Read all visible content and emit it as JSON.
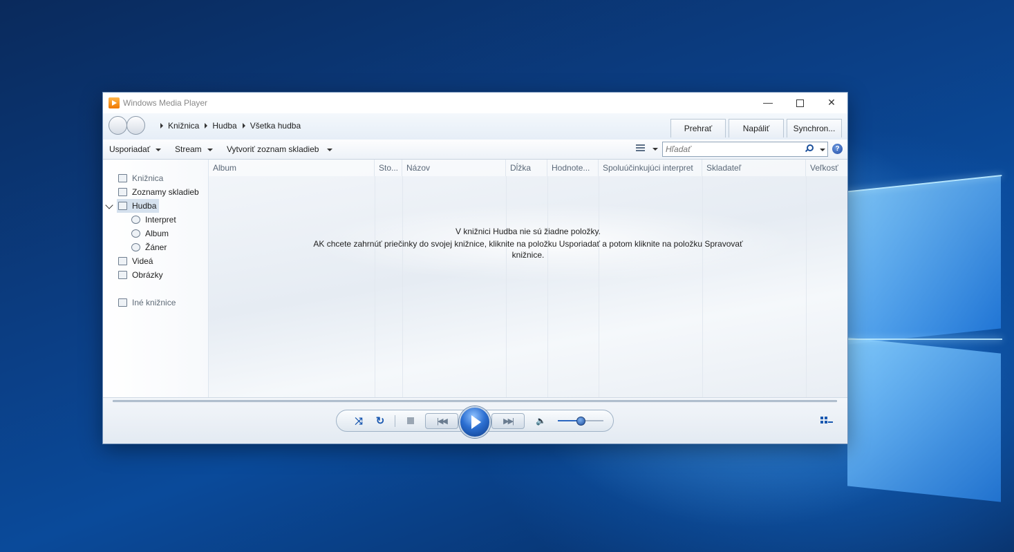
{
  "window": {
    "title": "Windows Media Player",
    "controls": {
      "minimize": "—",
      "close": "✕"
    }
  },
  "breadcrumb": [
    "Knižnica",
    "Hudba",
    "Všetka hudba"
  ],
  "tabs": {
    "play": "Prehrať",
    "burn": "Napáliť",
    "sync": "Synchron..."
  },
  "toolbar": {
    "organize": "Usporiadať",
    "stream": "Stream",
    "create_playlist": "Vytvoriť zoznam skladieb",
    "search_placeholder": "Hľadať",
    "help": "?"
  },
  "sidebar": {
    "library": "Knižnica",
    "playlists": "Zoznamy skladieb",
    "music": "Hudba",
    "artist": "Interpret",
    "album": "Album",
    "genre": "Žáner",
    "videos": "Videá",
    "pictures": "Obrázky",
    "other_libraries": "Iné knižnice"
  },
  "columns": [
    "Album",
    "Sto...",
    "Názov",
    "Dĺžka",
    "Hodnote...",
    "Spoluúčinkujúci interpret",
    "Skladateľ",
    "Veľkosť"
  ],
  "empty_message": {
    "line1": "V knižnici Hudba nie sú žiadne položky.",
    "line2": "AK chcete zahrnúť priečinky do svojej knižnice, kliknite na položku Usporiadať a potom kliknite na položku Spravovať",
    "line3": "knižnice."
  },
  "player": {
    "shuffle_glyph": "⤨",
    "repeat_glyph": "↻",
    "prev_glyph": "|◀◀",
    "next_glyph": "▶▶|",
    "speaker_glyph": "🔈",
    "volume_level": 0.5
  },
  "colors": {
    "accent": "#1a58b0",
    "window_bg": "#ffffff",
    "desktop": "#0b3f86"
  }
}
